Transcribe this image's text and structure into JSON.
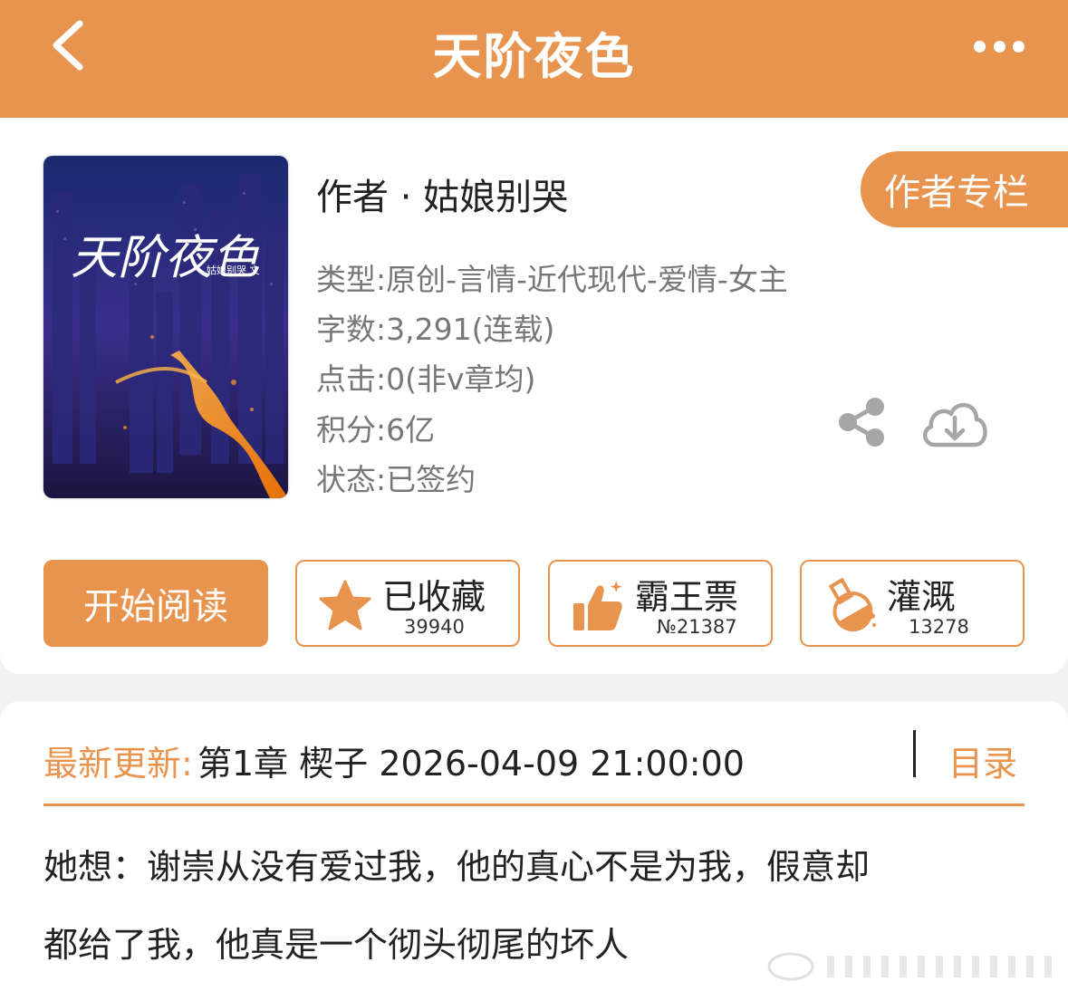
{
  "header": {
    "title": "天阶夜色",
    "back_icon": "chevron-left-icon",
    "more_icon": "ellipsis-icon"
  },
  "book": {
    "cover_title": "天阶夜色",
    "cover_author": "姑娘别哭 文",
    "author_line": "作者 · 姑娘别哭",
    "author_column_button": "作者专栏",
    "genre": "类型:原创-言情-近代现代-爱情-女主",
    "word_count": "字数:3,291(连载)",
    "clicks": "点击:0(非v章均)",
    "points": "积分:6亿",
    "status": "状态:已签约"
  },
  "actions": {
    "read_button": "开始阅读",
    "favorite": {
      "label": "已收藏",
      "count": "39940",
      "icon": "star-icon"
    },
    "vote": {
      "label": "霸王票",
      "count": "№21387",
      "icon": "thumbs-up-icon"
    },
    "nutrient": {
      "label": "灌溉",
      "count": "13278",
      "icon": "flask-icon"
    }
  },
  "latest": {
    "label": "最新更新:",
    "chapter": "第1章 楔子 2026-04-09 21:00:00",
    "toc_button": "目录",
    "summary_line1": "她想：谢崇从没有爱过我，他的真心不是为我，假意却",
    "summary_line2": "都给了我，他真是一个彻头彻尾的坏人"
  },
  "colors": {
    "accent": "#e8944f",
    "text_dark": "#222222",
    "text_meta": "#777777",
    "background": "#f2f2f2"
  }
}
